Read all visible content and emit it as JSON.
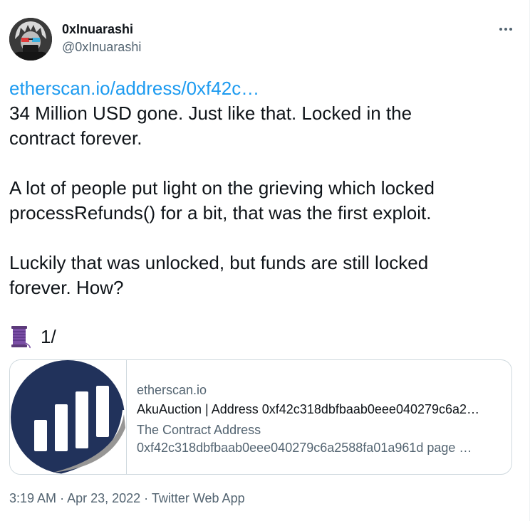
{
  "author": {
    "name": "0xInuarashi",
    "handle": "@0xInuarashi"
  },
  "tweet": {
    "link_text": "etherscan.io/address/0xf42c…",
    "paragraph1_line1": "34 Million USD gone. Just like that. Locked in the",
    "paragraph1_line2": "contract forever.",
    "paragraph2_line1": "A lot of people put light on the grieving which locked",
    "paragraph2_line2": "processRefunds() for a bit, that was the first exploit.",
    "paragraph3_line1": "Luckily that was unlocked, but funds are still locked",
    "paragraph3_line2": "forever. How?",
    "thread_emoji": "thread-spool-icon",
    "thread_count": "1/"
  },
  "card": {
    "domain": "etherscan.io",
    "title": "AkuAuction | Address 0xf42c318dbfbaab0eee040279c6a2…",
    "description_line1": "The Contract Address",
    "description_line2": "0xf42c318dbfbaab0eee040279c6a2588fa01a961d page …",
    "logo_colors": {
      "primary": "#21325b",
      "secondary": "#979695"
    }
  },
  "meta": {
    "time": "3:19 AM",
    "separator": "·",
    "date": "Apr 23, 2022",
    "source": "Twitter Web App"
  },
  "colors": {
    "text": "#0f1419",
    "secondary": "#536471",
    "link": "#1d9bf0",
    "border": "#cfd9de"
  }
}
